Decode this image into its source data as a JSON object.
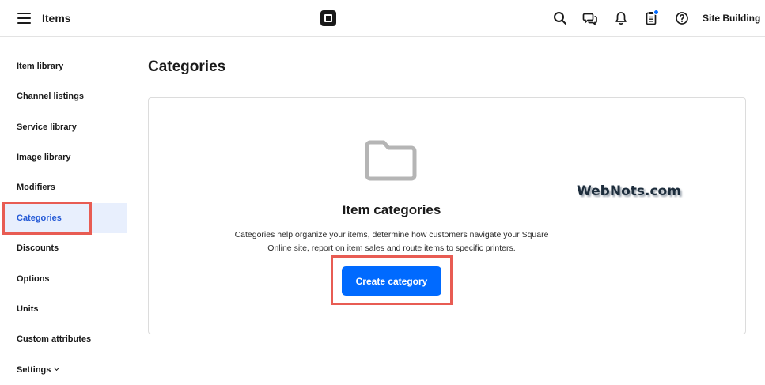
{
  "header": {
    "app_title": "Items",
    "account_label": "Site Building",
    "icons": [
      "menu-icon",
      "square-logo",
      "search-icon",
      "chat-icon",
      "bell-icon",
      "clipboard-icon",
      "help-icon"
    ],
    "notification_color": "#006aff"
  },
  "sidebar": {
    "items": [
      {
        "label": "Item library"
      },
      {
        "label": "Channel listings"
      },
      {
        "label": "Service library"
      },
      {
        "label": "Image library"
      },
      {
        "label": "Modifiers"
      },
      {
        "label": "Categories",
        "active": true
      },
      {
        "label": "Discounts"
      },
      {
        "label": "Options"
      },
      {
        "label": "Units"
      },
      {
        "label": "Custom attributes"
      },
      {
        "label": "Settings"
      }
    ],
    "active_color": "#2459d6",
    "active_bg": "#e8effd"
  },
  "main": {
    "title": "Categories",
    "empty_state": {
      "icon": "folder-icon",
      "heading": "Item categories",
      "description": "Categories help organize your items, determine how customers navigate your Square Online site, report on item sales and route items to specific printers.",
      "button_label": "Create category",
      "button_color": "#006aff"
    }
  },
  "annotation_color": "#e85c53",
  "watermark": "WebNots.com"
}
